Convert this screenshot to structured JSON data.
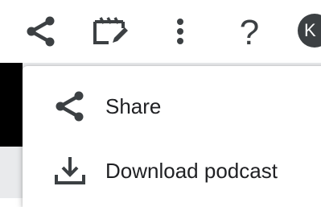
{
  "toolbar": {
    "icons": [
      "share-icon",
      "clapperboard-edit-icon",
      "more-vert-icon",
      "help-icon"
    ],
    "help_glyph": "?",
    "avatar_initial": "K"
  },
  "menu": {
    "items": [
      {
        "icon": "share-icon",
        "label": "Share"
      },
      {
        "icon": "download-icon",
        "label": "Download podcast"
      }
    ]
  },
  "colors": {
    "icon": "#3c4043",
    "text": "#202124",
    "avatar_bg": "#3c4043",
    "backdrop": "#e9eaec"
  }
}
